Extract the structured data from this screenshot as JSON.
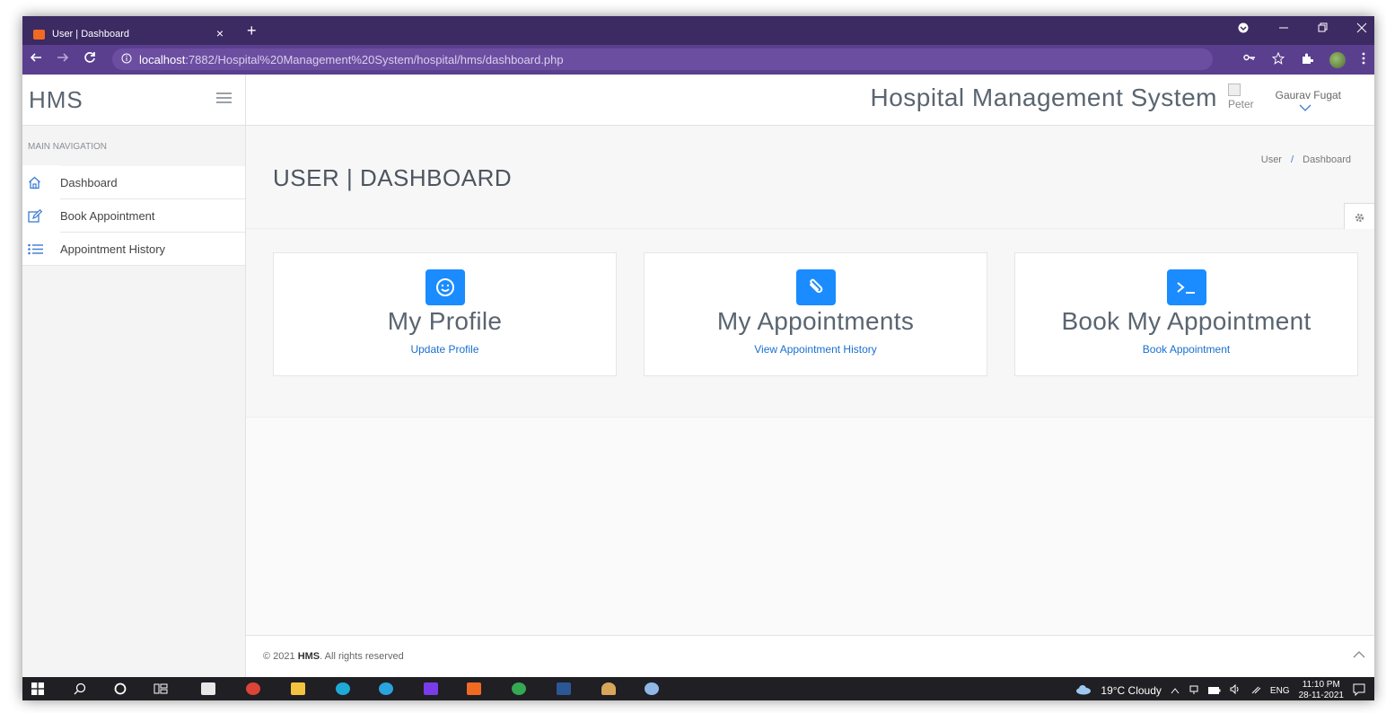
{
  "browser": {
    "tab_title": "User | Dashboard",
    "close_glyph": "×",
    "new_tab_glyph": "+",
    "url_host": "localhost",
    "url_path": ":7882/Hospital%20Management%20System/hospital/hms/dashboard.php",
    "accent": "#5b3f8f"
  },
  "sidebar": {
    "brand": "HMS",
    "nav_heading": "MAIN NAVIGATION",
    "items": [
      {
        "label": "Dashboard",
        "icon": "home-icon"
      },
      {
        "label": "Book Appointment",
        "icon": "edit-icon"
      },
      {
        "label": "Appointment History",
        "icon": "list-icon"
      }
    ]
  },
  "header": {
    "title": "Hospital Management System",
    "user_image_alt": "Peter",
    "user_name": "Gaurav Fugat"
  },
  "page": {
    "title": "USER | DASHBOARD",
    "breadcrumb": [
      "User",
      "Dashboard"
    ],
    "breadcrumb_sep": "/"
  },
  "cards": [
    {
      "title": "My Profile",
      "link": "Update Profile",
      "icon": "smile-icon"
    },
    {
      "title": "My Appointments",
      "link": "View Appointment History",
      "icon": "paperclip-icon"
    },
    {
      "title": "Book My Appointment",
      "link": "Book Appointment",
      "icon": "terminal-icon"
    }
  ],
  "footer": {
    "prefix": "© 2021 ",
    "brand": "HMS",
    "suffix": ". All rights reserved"
  },
  "taskbar": {
    "weather": "19°C Cloudy",
    "language": "ENG",
    "time": "11:10 PM",
    "date": "28-11-2021"
  },
  "colors": {
    "card_icon_bg": "#1a8cff",
    "link": "#1a6fd1"
  }
}
